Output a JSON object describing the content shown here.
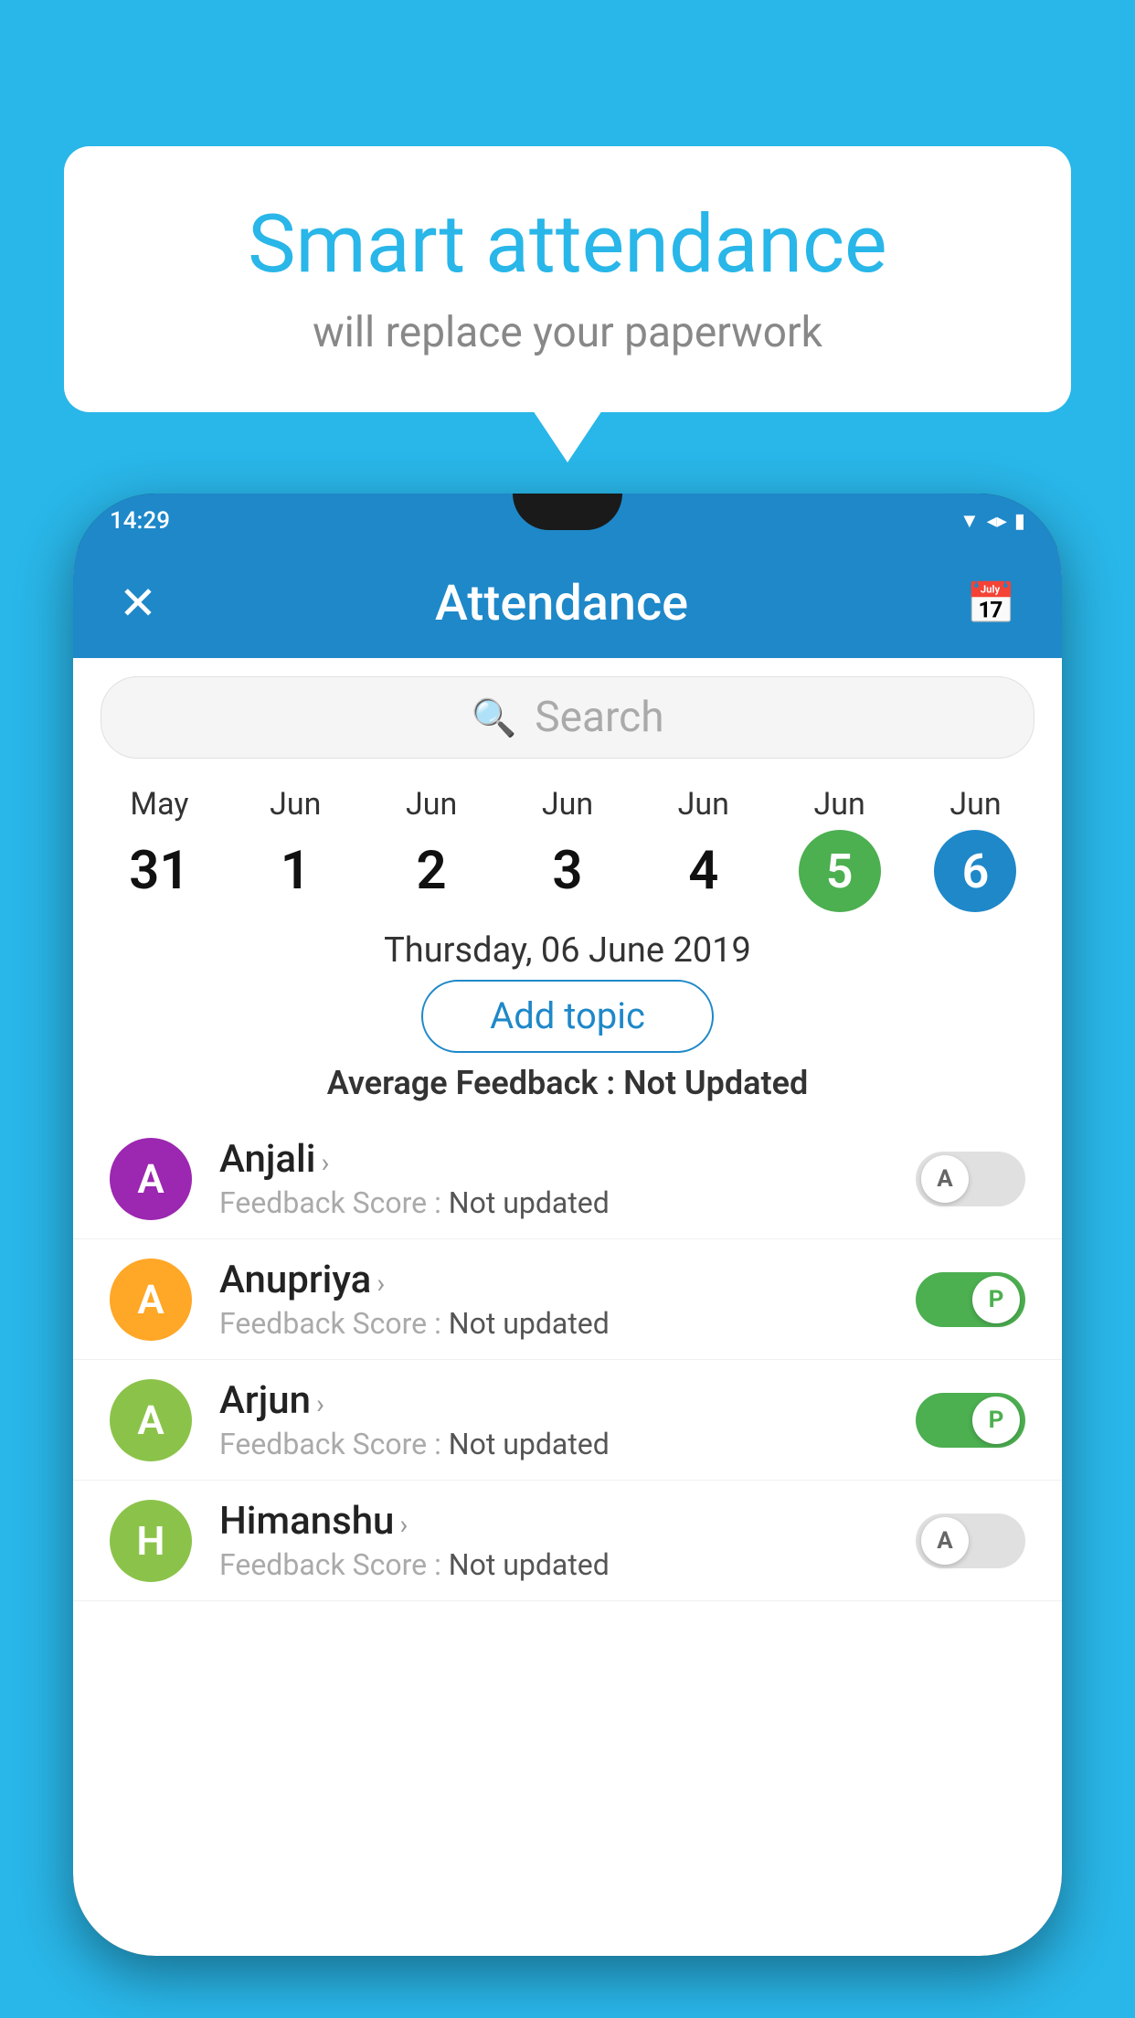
{
  "background_color": "#29b6e8",
  "speech_bubble": {
    "title": "Smart attendance",
    "subtitle": "will replace your paperwork"
  },
  "phone": {
    "status_bar": {
      "time": "14:29",
      "icons": [
        "wifi",
        "signal",
        "battery"
      ]
    },
    "header": {
      "title": "Attendance",
      "close_label": "✕",
      "calendar_icon": "📅"
    },
    "search": {
      "placeholder": "Search"
    },
    "calendar": {
      "days": [
        {
          "month": "May",
          "date": "31",
          "state": "normal"
        },
        {
          "month": "Jun",
          "date": "1",
          "state": "normal"
        },
        {
          "month": "Jun",
          "date": "2",
          "state": "normal"
        },
        {
          "month": "Jun",
          "date": "3",
          "state": "normal"
        },
        {
          "month": "Jun",
          "date": "4",
          "state": "normal"
        },
        {
          "month": "Jun",
          "date": "5",
          "state": "today"
        },
        {
          "month": "Jun",
          "date": "6",
          "state": "selected"
        }
      ]
    },
    "selected_date_label": "Thursday, 06 June 2019",
    "add_topic_label": "Add topic",
    "average_feedback": {
      "label": "Average Feedback : ",
      "value": "Not Updated"
    },
    "students": [
      {
        "name": "Anjali",
        "avatar_letter": "A",
        "avatar_color": "#9c27b0",
        "feedback_label": "Feedback Score : ",
        "feedback_value": "Not updated",
        "toggle_state": "off",
        "toggle_letter": "A"
      },
      {
        "name": "Anupriya",
        "avatar_letter": "A",
        "avatar_color": "#ffa726",
        "feedback_label": "Feedback Score : ",
        "feedback_value": "Not updated",
        "toggle_state": "on",
        "toggle_letter": "P"
      },
      {
        "name": "Arjun",
        "avatar_letter": "A",
        "avatar_color": "#8bc34a",
        "feedback_label": "Feedback Score : ",
        "feedback_value": "Not updated",
        "toggle_state": "on",
        "toggle_letter": "P"
      },
      {
        "name": "Himanshu",
        "avatar_letter": "H",
        "avatar_color": "#8bc34a",
        "feedback_label": "Feedback Score : ",
        "feedback_value": "Not updated",
        "toggle_state": "off",
        "toggle_letter": "A"
      }
    ]
  }
}
